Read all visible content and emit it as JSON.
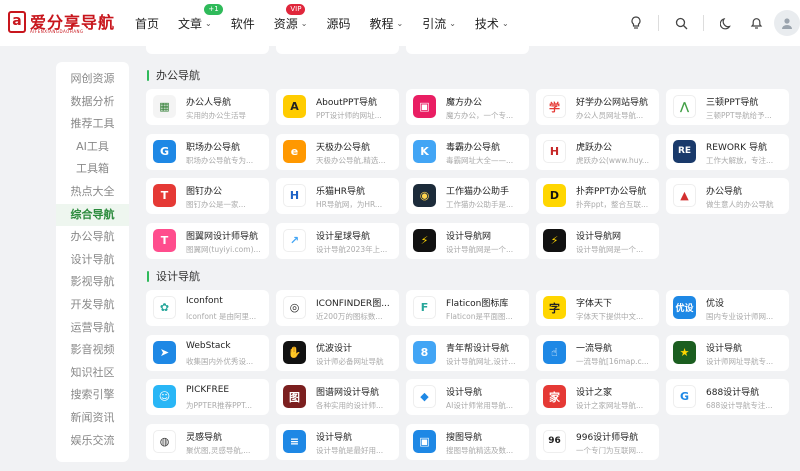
{
  "logo": {
    "mark": "a",
    "title": "爱分享导航",
    "subtitle": "AIFENXIANGDAOHANG"
  },
  "nav": [
    {
      "label": "首页",
      "chevron": false,
      "badge": null
    },
    {
      "label": "文章",
      "chevron": true,
      "badge": "+1"
    },
    {
      "label": "软件",
      "chevron": false,
      "badge": null
    },
    {
      "label": "资源",
      "chevron": true,
      "badge": "VIP"
    },
    {
      "label": "源码",
      "chevron": false,
      "badge": null
    },
    {
      "label": "教程",
      "chevron": true,
      "badge": null
    },
    {
      "label": "引流",
      "chevron": true,
      "badge": null
    },
    {
      "label": "技术",
      "chevron": true,
      "badge": null
    }
  ],
  "header_icons": [
    "lightbulb-icon",
    "search-icon",
    "moon-icon",
    "bell-icon",
    "user-icon"
  ],
  "sidebar": [
    {
      "label": "网创资源",
      "active": false
    },
    {
      "label": "数据分析",
      "active": false
    },
    {
      "label": "推荐工具",
      "active": false
    },
    {
      "label": "AI工具",
      "active": false
    },
    {
      "label": "工具箱",
      "active": false
    },
    {
      "label": "热点大全",
      "active": false
    },
    {
      "label": "综合导航",
      "active": true
    },
    {
      "label": "办公导航",
      "active": false
    },
    {
      "label": "设计导航",
      "active": false
    },
    {
      "label": "影视导航",
      "active": false
    },
    {
      "label": "开发导航",
      "active": false
    },
    {
      "label": "运营导航",
      "active": false
    },
    {
      "label": "影音视频",
      "active": false
    },
    {
      "label": "知识社区",
      "active": false
    },
    {
      "label": "搜索引擎",
      "active": false
    },
    {
      "label": "新闻资讯",
      "active": false
    },
    {
      "label": "娱乐交流",
      "active": false
    }
  ],
  "sections": [
    {
      "title": "办公导航",
      "items": [
        {
          "name": "办公人导航",
          "desc": "实用的办公生活导",
          "icon_text": "▦",
          "icon_bg": "#f4f4f4",
          "icon_fg": "#2e7d32"
        },
        {
          "name": "AboutPPT导航",
          "desc": "PPT设计师的网址...",
          "icon_text": "A",
          "icon_bg": "#ffcc00",
          "icon_fg": "#222222"
        },
        {
          "name": "魔方办公",
          "desc": "魔方办公，一个专...",
          "icon_text": "▣",
          "icon_bg": "#e91e63",
          "icon_fg": "#ffffff"
        },
        {
          "name": "好学办公网站导航",
          "desc": "办公人员网址导航...",
          "icon_text": "学",
          "icon_bg": "#ffffff",
          "icon_fg": "#e53935"
        },
        {
          "name": "三顿PPT导航",
          "desc": "三顿PPT导航给予...",
          "icon_text": "⋀",
          "icon_bg": "#ffffff",
          "icon_fg": "#43a047"
        },
        {
          "name": "职场办公导航",
          "desc": "职场办公导航专为...",
          "icon_text": "G",
          "icon_bg": "#1e88e5",
          "icon_fg": "#ffffff"
        },
        {
          "name": "天极办公导航",
          "desc": "天极办公导航,精选...",
          "icon_text": "e",
          "icon_bg": "#ff9800",
          "icon_fg": "#ffffff"
        },
        {
          "name": "毒霸办公导航",
          "desc": "毒霸网址大全——...",
          "icon_text": "K",
          "icon_bg": "#42a5f5",
          "icon_fg": "#ffffff"
        },
        {
          "name": "虎跃办公",
          "desc": "虎跃办公(www.huy...",
          "icon_text": "H",
          "icon_bg": "#ffffff",
          "icon_fg": "#c62828"
        },
        {
          "name": "REWORK 导航",
          "desc": "工作大解放，专注...",
          "icon_text": "RE",
          "icon_bg": "#1a3a6b",
          "icon_fg": "#ffffff"
        },
        {
          "name": "图钉办公",
          "desc": "图钉办公是一家...",
          "icon_text": "T",
          "icon_bg": "#e53935",
          "icon_fg": "#ffffff"
        },
        {
          "name": "乐猫HR导航",
          "desc": "HR导航网，为HR...",
          "icon_text": "H",
          "icon_bg": "#ffffff",
          "icon_fg": "#1e63c7"
        },
        {
          "name": "工作猫办公助手",
          "desc": "工作猫办公助手是...",
          "icon_text": "◉",
          "icon_bg": "#1c2b3a",
          "icon_fg": "#ffd54f"
        },
        {
          "name": "扑奔PPT办公导航",
          "desc": "扑奔ppt，整合互联...",
          "icon_text": "D",
          "icon_bg": "#ffd600",
          "icon_fg": "#111111"
        },
        {
          "name": "办公导航",
          "desc": "做生意人的办公导航",
          "icon_text": "▲",
          "icon_bg": "#ffffff",
          "icon_fg": "#d32f2f"
        },
        {
          "name": "图翼网设计师导航",
          "desc": "图翼网(tuyiyi.com)...",
          "icon_text": "T",
          "icon_bg": "#ff4d8d",
          "icon_fg": "#ffffff"
        },
        {
          "name": "设计星球导航",
          "desc": "设计导航2023年上...",
          "icon_text": "↗",
          "icon_bg": "#ffffff",
          "icon_fg": "#42a5f5"
        },
        {
          "name": "设计导航网",
          "desc": "设计导航网是一个...",
          "icon_text": "⚡",
          "icon_bg": "#111111",
          "icon_fg": "#ffd600"
        },
        {
          "name": "设计导航网",
          "desc": "设计导航网是一个...",
          "icon_text": "⚡",
          "icon_bg": "#111111",
          "icon_fg": "#ffd600"
        }
      ]
    },
    {
      "title": "设计导航",
      "items": [
        {
          "name": "Iconfont",
          "desc": "Iconfont 是由阿里...",
          "icon_text": "✿",
          "icon_bg": "#ffffff",
          "icon_fg": "#26a69a"
        },
        {
          "name": "ICONFINDER图...",
          "desc": "近200万的图标数...",
          "icon_text": "◎",
          "icon_bg": "#ffffff",
          "icon_fg": "#222222"
        },
        {
          "name": "Flaticon图标库",
          "desc": "Flaticon是平面图...",
          "icon_text": "F",
          "icon_bg": "#ffffff",
          "icon_fg": "#26a69a"
        },
        {
          "name": "字体天下",
          "desc": "字体天下提供中文...",
          "icon_text": "字",
          "icon_bg": "#ffd600",
          "icon_fg": "#222222"
        },
        {
          "name": "优设",
          "desc": "国内专业设计师网...",
          "icon_text": "优设",
          "icon_bg": "#1e88e5",
          "icon_fg": "#ffffff"
        },
        {
          "name": "WebStack",
          "desc": "收集国内外优秀设...",
          "icon_text": "➤",
          "icon_bg": "#1e88e5",
          "icon_fg": "#ffffff"
        },
        {
          "name": "优波设计",
          "desc": "设计师必备网址导航",
          "icon_text": "✋",
          "icon_bg": "#111111",
          "icon_fg": "#ffffff"
        },
        {
          "name": "青年帮设计导航",
          "desc": "设计导航网址,设计...",
          "icon_text": "8",
          "icon_bg": "#42a5f5",
          "icon_fg": "#ffffff"
        },
        {
          "name": "一流导航",
          "desc": "一流导航[16map.c...",
          "icon_text": "☝",
          "icon_bg": "#1e88e5",
          "icon_fg": "#ffffff"
        },
        {
          "name": "设计导航",
          "desc": "设计师网址导航专...",
          "icon_text": "★",
          "icon_bg": "#1b5e20",
          "icon_fg": "#ffd600"
        },
        {
          "name": "PICKFREE",
          "desc": "为PPTER推荐PPT...",
          "icon_text": "☺",
          "icon_bg": "#29b6f6",
          "icon_fg": "#ffffff"
        },
        {
          "name": "图谱网设计导航",
          "desc": "各种实用的设计师...",
          "icon_text": "图",
          "icon_bg": "#7b1f1f",
          "icon_fg": "#ffffff"
        },
        {
          "name": "设计导航",
          "desc": "AI设计师常用导航...",
          "icon_text": "◆",
          "icon_bg": "#ffffff",
          "icon_fg": "#1e88e5"
        },
        {
          "name": "设计之家",
          "desc": "设计之家网址导航...",
          "icon_text": "家",
          "icon_bg": "#e53935",
          "icon_fg": "#ffffff"
        },
        {
          "name": "688设计导航",
          "desc": "688设计导航专注...",
          "icon_text": "G",
          "icon_bg": "#ffffff",
          "icon_fg": "#1e88e5"
        },
        {
          "name": "灵感导航",
          "desc": "聚优图,灵感导航,...",
          "icon_text": "◍",
          "icon_bg": "#ffffff",
          "icon_fg": "#333333"
        },
        {
          "name": "设计导航",
          "desc": "设计导航是最好用...",
          "icon_text": "≡",
          "icon_bg": "#1e88e5",
          "icon_fg": "#ffffff"
        },
        {
          "name": "搜图导航",
          "desc": "搜图导航精选及数...",
          "icon_text": "▣",
          "icon_bg": "#1e88e5",
          "icon_fg": "#ffffff"
        },
        {
          "name": "996设计师导航",
          "desc": "一个专门为互联网...",
          "icon_text": "96",
          "icon_bg": "#ffffff",
          "icon_fg": "#222222"
        }
      ]
    }
  ]
}
